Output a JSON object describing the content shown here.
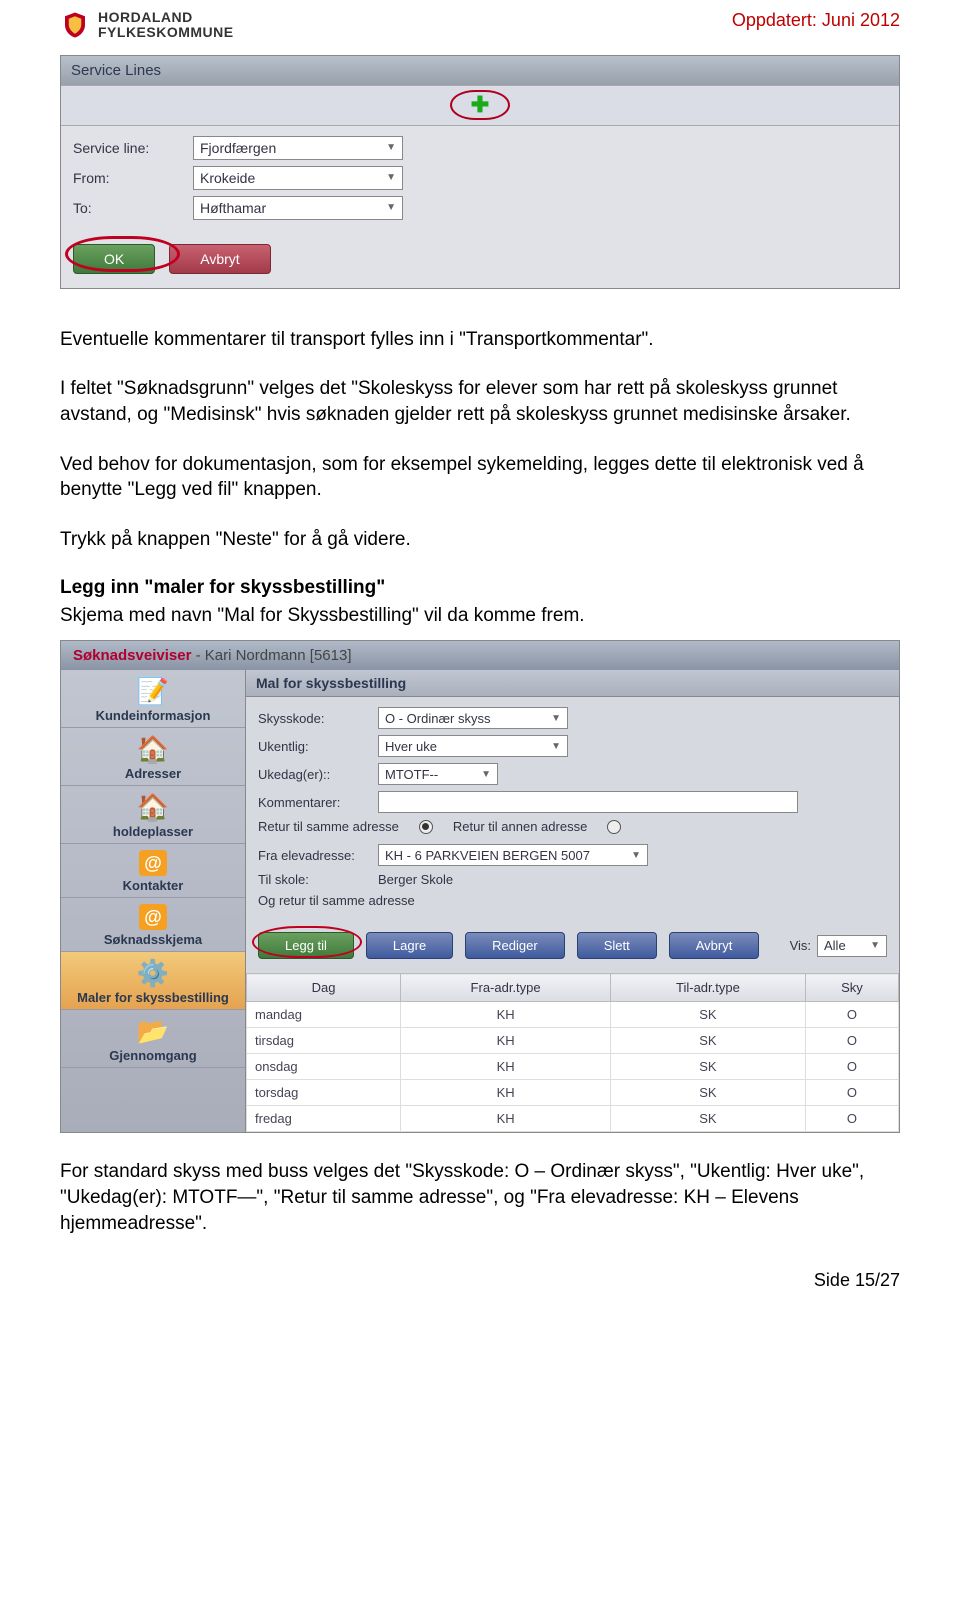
{
  "header": {
    "org1": "HORDALAND",
    "org2": "FYLKESKOMMUNE",
    "updated": "Oppdatert: Juni 2012"
  },
  "screenshot1": {
    "title": "Service Lines",
    "fields": {
      "service_line_label": "Service line:",
      "service_line_value": "Fjordfærgen",
      "from_label": "From:",
      "from_value": "Krokeide",
      "to_label": "To:",
      "to_value": "Høfthamar"
    },
    "buttons": {
      "ok": "OK",
      "cancel": "Avbryt"
    }
  },
  "body": {
    "p1": "Eventuelle kommentarer til transport fylles inn i \"Transportkommentar\".",
    "p2": "I feltet \"Søknadsgrunn\" velges det \"Skoleskyss for elever som har rett på skoleskyss grunnet avstand, og \"Medisinsk\" hvis søknaden gjelder rett på skoleskyss grunnet medisinske årsaker.",
    "p3": "Ved behov for dokumentasjon, som for eksempel sykemelding, legges dette til elektronisk ved å benytte \"Legg ved fil\" knappen.",
    "p4": "Trykk på knappen \"Neste\" for å gå videre.",
    "h3": "Legg inn \"maler for skyssbestilling\"",
    "p5": "Skjema med navn \"Mal for Skyssbestilling\" vil da komme frem.",
    "p6": "For standard skyss med buss velges det \"Skysskode: O – Ordinær skyss\", \"Ukentlig: Hver uke\", \"Ukedag(er): MTOTF—\", \"Retur til samme adresse\", og \"Fra elevadresse: KH – Elevens hjemmeadresse\"."
  },
  "wizard": {
    "title": "Søknadsveiviser",
    "subtitle": "- Kari Nordmann [5613]",
    "sidebar": [
      "Kundeinformasjon",
      "Adresser",
      "holdeplasser",
      "Kontakter",
      "Søknadsskjema",
      "Maler for skyssbestilling",
      "Gjennomgang"
    ],
    "main_title": "Mal for skyssbestilling",
    "form": {
      "skysskode_l": "Skysskode:",
      "skysskode_v": "O - Ordinær skyss",
      "ukentlig_l": "Ukentlig:",
      "ukentlig_v": "Hver uke",
      "ukedag_l": "Ukedag(er)::",
      "ukedag_v": "MTOTF--",
      "kommentar_l": "Kommentarer:",
      "kommentar_v": "",
      "radio1": "Retur til samme adresse",
      "radio2": "Retur til annen adresse",
      "fra_l": "Fra elevadresse:",
      "fra_v": "KH - 6 PARKVEIEN BERGEN 5007",
      "til_l": "Til skole:",
      "til_v": "Berger Skole",
      "ret_l": "Og retur til samme adresse"
    },
    "buttons": {
      "add": "Legg til",
      "save": "Lagre",
      "edit": "Rediger",
      "del": "Slett",
      "cancel": "Avbryt"
    },
    "vis_label": "Vis:",
    "vis_value": "Alle",
    "table": {
      "headers": [
        "Dag",
        "Fra-adr.type",
        "Til-adr.type",
        "Sky"
      ],
      "rows": [
        [
          "mandag",
          "KH",
          "SK",
          "O"
        ],
        [
          "tirsdag",
          "KH",
          "SK",
          "O"
        ],
        [
          "onsdag",
          "KH",
          "SK",
          "O"
        ],
        [
          "torsdag",
          "KH",
          "SK",
          "O"
        ],
        [
          "fredag",
          "KH",
          "SK",
          "O"
        ]
      ]
    }
  },
  "footer": {
    "page": "Side 15/27"
  }
}
